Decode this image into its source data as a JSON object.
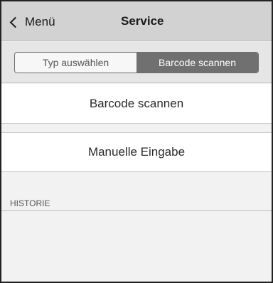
{
  "navbar": {
    "back_label": "Menü",
    "title": "Service"
  },
  "segmented_control": {
    "options": [
      {
        "label": "Typ auswählen",
        "selected": false
      },
      {
        "label": "Barcode scannen",
        "selected": true
      }
    ]
  },
  "actions": {
    "scan_label": "Barcode scannen",
    "manual_label": "Manuelle Eingabe"
  },
  "history": {
    "header": "HISTORIE",
    "items": []
  },
  "icons": {
    "back": "chevron-left-icon"
  },
  "colors": {
    "navbar_bg": "#d2d2d2",
    "segment_active_bg": "#707070",
    "page_bg": "#f2f2f2"
  }
}
